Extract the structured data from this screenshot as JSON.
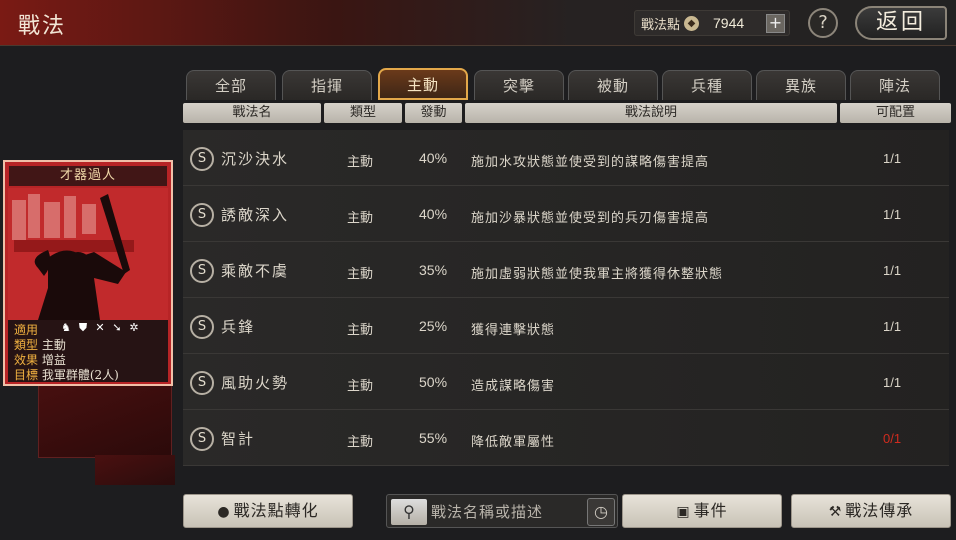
{
  "header": {
    "title": "戰法",
    "points_label": "戰法點",
    "points_icon": "coin-icon",
    "points_value": "7944",
    "add_label": "+",
    "help_label": "?",
    "back_label": "返回"
  },
  "tabs": [
    {
      "label": "全部"
    },
    {
      "label": "指揮"
    },
    {
      "label": "主動",
      "active": true
    },
    {
      "label": "突擊"
    },
    {
      "label": "被動"
    },
    {
      "label": "兵種"
    },
    {
      "label": "異族"
    },
    {
      "label": "陣法"
    }
  ],
  "columns": {
    "name": "戰法名",
    "type": "類型",
    "rate": "發動",
    "desc": "戰法說明",
    "count": "可配置"
  },
  "rows": [
    {
      "badge": "S",
      "name": "沉沙決水",
      "type": "主動",
      "rate": "40%",
      "desc": "施加水攻狀態並使受到的謀略傷害提高",
      "count": "1/1",
      "count_color": "#dcd6ca"
    },
    {
      "badge": "S",
      "name": "誘敵深入",
      "type": "主動",
      "rate": "40%",
      "desc": "施加沙暴狀態並使受到的兵刃傷害提高",
      "count": "1/1",
      "count_color": "#dcd6ca"
    },
    {
      "badge": "S",
      "name": "乘敵不虞",
      "type": "主動",
      "rate": "35%",
      "desc": "施加虛弱狀態並使我軍主將獲得休整狀態",
      "count": "1/1",
      "count_color": "#dcd6ca"
    },
    {
      "badge": "S",
      "name": "兵鋒",
      "type": "主動",
      "rate": "25%",
      "desc": "獲得連擊狀態",
      "count": "1/1",
      "count_color": "#dcd6ca"
    },
    {
      "badge": "S",
      "name": "風助火勢",
      "type": "主動",
      "rate": "50%",
      "desc": "造成謀略傷害",
      "count": "1/1",
      "count_color": "#dcd6ca"
    },
    {
      "badge": "S",
      "name": "智計",
      "type": "主動",
      "rate": "55%",
      "desc": "降低敵軍屬性",
      "count": "0/1",
      "count_color": "#d12b1f"
    }
  ],
  "card": {
    "title": "才器過人",
    "apply_key": "適用",
    "apply_icons": [
      "cavalry-icon",
      "shield-icon",
      "bow-icon",
      "spear-icon",
      "wheel-icon"
    ],
    "type_key": "類型",
    "type_val": "主動",
    "effect_key": "效果",
    "effect_val": "增益",
    "target_key": "目標",
    "target_val": "我軍群體(2人)"
  },
  "bottom": {
    "convert_label": "戰法點轉化",
    "search_placeholder": "戰法名稱或描述",
    "event_label": "事件",
    "inherit_label": "戰法傳承"
  }
}
